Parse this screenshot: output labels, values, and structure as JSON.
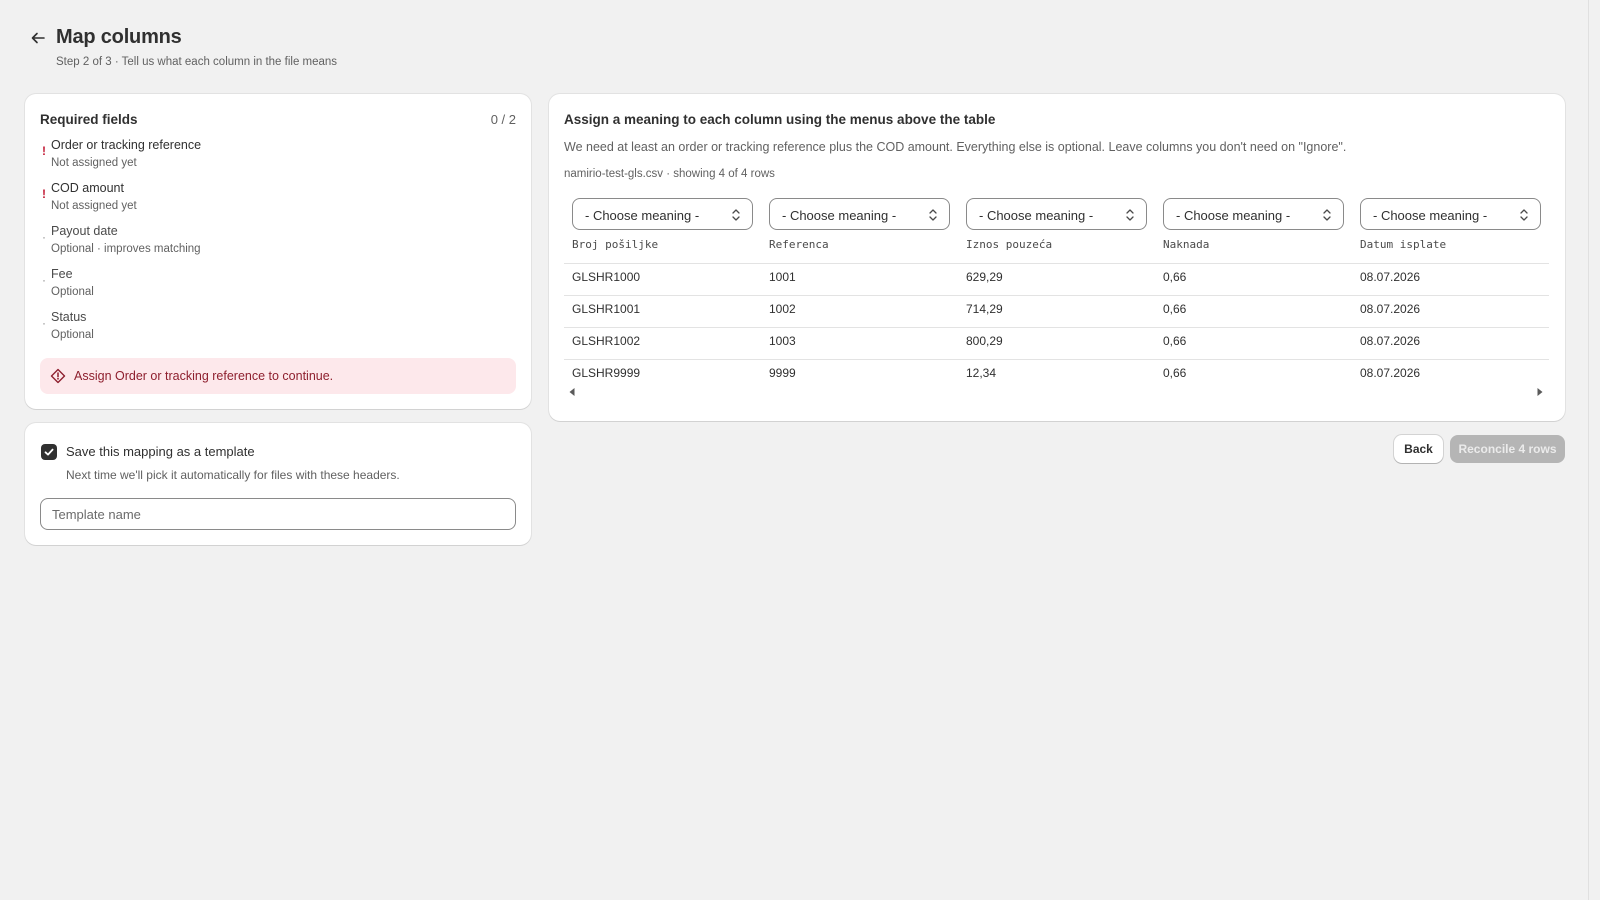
{
  "header": {
    "title": "Map columns",
    "subtitle": "Step 2 of 3 · Tell us what each column in the file means"
  },
  "required": {
    "title": "Required fields",
    "count": "0 / 2",
    "fields": [
      {
        "name": "Order or tracking reference",
        "status": "Not assigned yet",
        "mark": "!"
      },
      {
        "name": "COD amount",
        "status": "Not assigned yet",
        "mark": "!"
      },
      {
        "name": "Payout date",
        "status": "Optional · improves matching",
        "mark": "·"
      },
      {
        "name": "Fee",
        "status": "Optional",
        "mark": "·"
      },
      {
        "name": "Status",
        "status": "Optional",
        "mark": "·"
      }
    ],
    "alert": "Assign Order or tracking reference to continue."
  },
  "template": {
    "checkbox_label": "Save this mapping as a template",
    "checked": true,
    "help": "Next time we'll pick it automatically for files with these headers.",
    "input_placeholder": "Template name",
    "input_value": ""
  },
  "mapping": {
    "title": "Assign a meaning to each column using the menus above the table",
    "description": "We need at least an order or tracking reference plus the COD amount. Everything else is optional. Leave columns you don't need on \"Ignore\".",
    "file_info": "namirio-test-gls.csv · showing 4 of 4 rows",
    "select_placeholder": "- Choose meaning -",
    "columns": [
      "Broj pošiljke",
      "Referenca",
      "Iznos pouzeća",
      "Naknada",
      "Datum isplate"
    ],
    "rows": [
      [
        "GLSHR1000",
        "1001",
        "629,29",
        "0,66",
        "08.07.2026"
      ],
      [
        "GLSHR1001",
        "1002",
        "714,29",
        "0,66",
        "08.07.2026"
      ],
      [
        "GLSHR1002",
        "1003",
        "800,29",
        "0,66",
        "08.07.2026"
      ],
      [
        "GLSHR9999",
        "9999",
        "12,34",
        "0,66",
        "08.07.2026"
      ]
    ]
  },
  "actions": {
    "back_label": "Back",
    "primary_label": "Reconcile 4 rows"
  },
  "colors": {
    "background": "#f1f1f1",
    "critical": "#c4203a",
    "critical_bg": "#fde8eb",
    "disabled_button": "#b5b5b5"
  }
}
